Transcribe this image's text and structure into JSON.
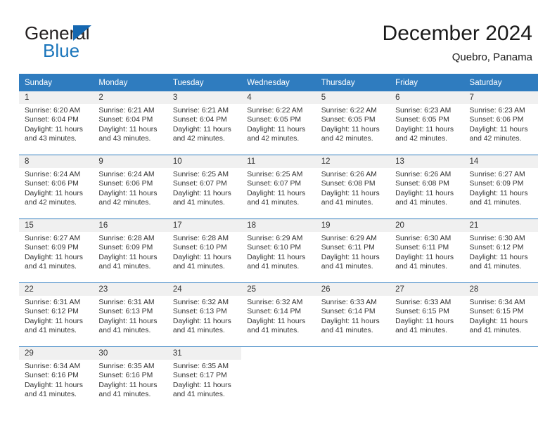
{
  "brand": {
    "word_one": "General",
    "word_two": "Blue",
    "triangle_color": "#1567b0",
    "blue_color": "#1a75bb"
  },
  "header": {
    "title": "December 2024",
    "subtitle": "Quebro, Panama"
  },
  "theme": {
    "header_blue": "#2f7cbf",
    "daynum_band": "#f0f0f0",
    "text": "#333333"
  },
  "labels": {
    "sunrise_prefix": "Sunrise:",
    "sunset_prefix": "Sunset:",
    "daylight_prefix": "Daylight:"
  },
  "weekdays": [
    "Sunday",
    "Monday",
    "Tuesday",
    "Wednesday",
    "Thursday",
    "Friday",
    "Saturday"
  ],
  "weeks": [
    [
      {
        "day": "1",
        "sunrise": "Sunrise: 6:20 AM",
        "sunset": "Sunset: 6:04 PM",
        "daylight": "Daylight: 11 hours and 43 minutes."
      },
      {
        "day": "2",
        "sunrise": "Sunrise: 6:21 AM",
        "sunset": "Sunset: 6:04 PM",
        "daylight": "Daylight: 11 hours and 43 minutes."
      },
      {
        "day": "3",
        "sunrise": "Sunrise: 6:21 AM",
        "sunset": "Sunset: 6:04 PM",
        "daylight": "Daylight: 11 hours and 42 minutes."
      },
      {
        "day": "4",
        "sunrise": "Sunrise: 6:22 AM",
        "sunset": "Sunset: 6:05 PM",
        "daylight": "Daylight: 11 hours and 42 minutes."
      },
      {
        "day": "5",
        "sunrise": "Sunrise: 6:22 AM",
        "sunset": "Sunset: 6:05 PM",
        "daylight": "Daylight: 11 hours and 42 minutes."
      },
      {
        "day": "6",
        "sunrise": "Sunrise: 6:23 AM",
        "sunset": "Sunset: 6:05 PM",
        "daylight": "Daylight: 11 hours and 42 minutes."
      },
      {
        "day": "7",
        "sunrise": "Sunrise: 6:23 AM",
        "sunset": "Sunset: 6:06 PM",
        "daylight": "Daylight: 11 hours and 42 minutes."
      }
    ],
    [
      {
        "day": "8",
        "sunrise": "Sunrise: 6:24 AM",
        "sunset": "Sunset: 6:06 PM",
        "daylight": "Daylight: 11 hours and 42 minutes."
      },
      {
        "day": "9",
        "sunrise": "Sunrise: 6:24 AM",
        "sunset": "Sunset: 6:06 PM",
        "daylight": "Daylight: 11 hours and 42 minutes."
      },
      {
        "day": "10",
        "sunrise": "Sunrise: 6:25 AM",
        "sunset": "Sunset: 6:07 PM",
        "daylight": "Daylight: 11 hours and 41 minutes."
      },
      {
        "day": "11",
        "sunrise": "Sunrise: 6:25 AM",
        "sunset": "Sunset: 6:07 PM",
        "daylight": "Daylight: 11 hours and 41 minutes."
      },
      {
        "day": "12",
        "sunrise": "Sunrise: 6:26 AM",
        "sunset": "Sunset: 6:08 PM",
        "daylight": "Daylight: 11 hours and 41 minutes."
      },
      {
        "day": "13",
        "sunrise": "Sunrise: 6:26 AM",
        "sunset": "Sunset: 6:08 PM",
        "daylight": "Daylight: 11 hours and 41 minutes."
      },
      {
        "day": "14",
        "sunrise": "Sunrise: 6:27 AM",
        "sunset": "Sunset: 6:09 PM",
        "daylight": "Daylight: 11 hours and 41 minutes."
      }
    ],
    [
      {
        "day": "15",
        "sunrise": "Sunrise: 6:27 AM",
        "sunset": "Sunset: 6:09 PM",
        "daylight": "Daylight: 11 hours and 41 minutes."
      },
      {
        "day": "16",
        "sunrise": "Sunrise: 6:28 AM",
        "sunset": "Sunset: 6:09 PM",
        "daylight": "Daylight: 11 hours and 41 minutes."
      },
      {
        "day": "17",
        "sunrise": "Sunrise: 6:28 AM",
        "sunset": "Sunset: 6:10 PM",
        "daylight": "Daylight: 11 hours and 41 minutes."
      },
      {
        "day": "18",
        "sunrise": "Sunrise: 6:29 AM",
        "sunset": "Sunset: 6:10 PM",
        "daylight": "Daylight: 11 hours and 41 minutes."
      },
      {
        "day": "19",
        "sunrise": "Sunrise: 6:29 AM",
        "sunset": "Sunset: 6:11 PM",
        "daylight": "Daylight: 11 hours and 41 minutes."
      },
      {
        "day": "20",
        "sunrise": "Sunrise: 6:30 AM",
        "sunset": "Sunset: 6:11 PM",
        "daylight": "Daylight: 11 hours and 41 minutes."
      },
      {
        "day": "21",
        "sunrise": "Sunrise: 6:30 AM",
        "sunset": "Sunset: 6:12 PM",
        "daylight": "Daylight: 11 hours and 41 minutes."
      }
    ],
    [
      {
        "day": "22",
        "sunrise": "Sunrise: 6:31 AM",
        "sunset": "Sunset: 6:12 PM",
        "daylight": "Daylight: 11 hours and 41 minutes."
      },
      {
        "day": "23",
        "sunrise": "Sunrise: 6:31 AM",
        "sunset": "Sunset: 6:13 PM",
        "daylight": "Daylight: 11 hours and 41 minutes."
      },
      {
        "day": "24",
        "sunrise": "Sunrise: 6:32 AM",
        "sunset": "Sunset: 6:13 PM",
        "daylight": "Daylight: 11 hours and 41 minutes."
      },
      {
        "day": "25",
        "sunrise": "Sunrise: 6:32 AM",
        "sunset": "Sunset: 6:14 PM",
        "daylight": "Daylight: 11 hours and 41 minutes."
      },
      {
        "day": "26",
        "sunrise": "Sunrise: 6:33 AM",
        "sunset": "Sunset: 6:14 PM",
        "daylight": "Daylight: 11 hours and 41 minutes."
      },
      {
        "day": "27",
        "sunrise": "Sunrise: 6:33 AM",
        "sunset": "Sunset: 6:15 PM",
        "daylight": "Daylight: 11 hours and 41 minutes."
      },
      {
        "day": "28",
        "sunrise": "Sunrise: 6:34 AM",
        "sunset": "Sunset: 6:15 PM",
        "daylight": "Daylight: 11 hours and 41 minutes."
      }
    ],
    [
      {
        "day": "29",
        "sunrise": "Sunrise: 6:34 AM",
        "sunset": "Sunset: 6:16 PM",
        "daylight": "Daylight: 11 hours and 41 minutes."
      },
      {
        "day": "30",
        "sunrise": "Sunrise: 6:35 AM",
        "sunset": "Sunset: 6:16 PM",
        "daylight": "Daylight: 11 hours and 41 minutes."
      },
      {
        "day": "31",
        "sunrise": "Sunrise: 6:35 AM",
        "sunset": "Sunset: 6:17 PM",
        "daylight": "Daylight: 11 hours and 41 minutes."
      },
      {
        "day": "",
        "sunrise": "",
        "sunset": "",
        "daylight": ""
      },
      {
        "day": "",
        "sunrise": "",
        "sunset": "",
        "daylight": ""
      },
      {
        "day": "",
        "sunrise": "",
        "sunset": "",
        "daylight": ""
      },
      {
        "day": "",
        "sunrise": "",
        "sunset": "",
        "daylight": ""
      }
    ]
  ]
}
